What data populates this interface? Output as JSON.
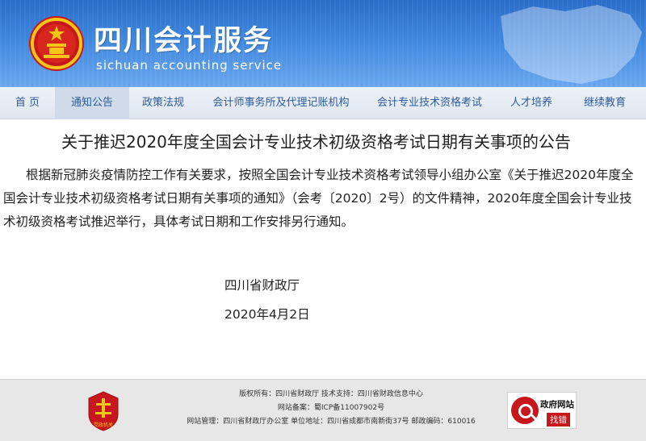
{
  "header": {
    "title": "四川会计服务",
    "subtitle": "sichuan accounting service",
    "emblem_icon": "national-emblem-icon",
    "background_color": "#3d86de"
  },
  "nav": {
    "items": [
      {
        "label": "首 页",
        "active": false
      },
      {
        "label": "通知公告",
        "active": true
      },
      {
        "label": "政策法规",
        "active": false
      },
      {
        "label": "会计师事务所及代理记账机构",
        "active": false
      },
      {
        "label": "会计专业技术资格考试",
        "active": false
      },
      {
        "label": "人才培养",
        "active": false
      },
      {
        "label": "继续教育",
        "active": false
      }
    ]
  },
  "article": {
    "title": "关于推迟2020年度全国会计专业技术初级资格考试日期有关事项的公告",
    "paragraph": "根据新冠肺炎疫情防控工作有关要求，按照全国会计专业技术资格考试领导小组办公室《关于推迟2020年度全国会计专业技术初级资格考试日期有关事项的通知》（会考〔2020〕2号）的文件精神，2020年度全国会计专业技术初级资格考试推迟举行，具体考试日期和工作安排另行通知。",
    "issuer": "四川省财政厅",
    "date": "2020年4月2日"
  },
  "footer": {
    "line1": "版权所有：四川省财政厅 技术支持：四川省财政信息中心",
    "line2": "网站备案：蜀ICP备11007902号",
    "line3": "网站管理：四川省财政厅办公室 单位地址：四川省成都市南新街37号 邮政编码：610016",
    "left_badge_text": "党政机关",
    "right_badge_title": "政府网站",
    "right_badge_action": "找错"
  }
}
